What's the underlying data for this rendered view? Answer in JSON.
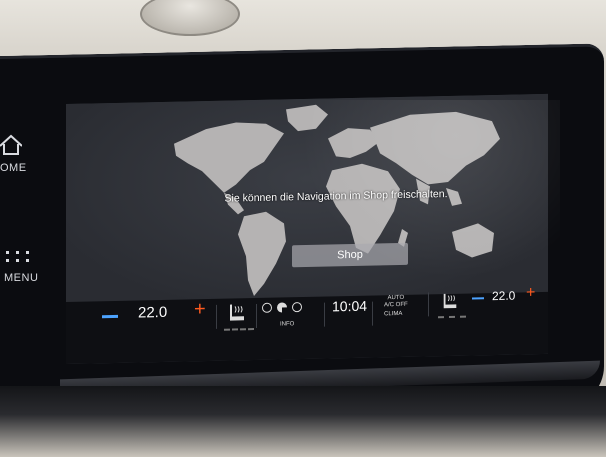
{
  "left_rail": {
    "home_label": "OME",
    "menu_label": "MENU"
  },
  "navigation": {
    "message": "Sie können die Navigation im Shop freischalten.",
    "shop_button_label": "Shop"
  },
  "climate": {
    "left_temp": "22.0",
    "right_temp": "22.0",
    "clock": "10:04",
    "info_label": "INFO",
    "auto_label": "AUTO",
    "ac_off_label": "A/C OFF",
    "climate_label": "CLIMA"
  },
  "colors": {
    "accent_plus": "#ff5a1f",
    "accent_minus": "#4da3ff",
    "screen_bg": "#33363d",
    "bar_bg": "#0e0f13"
  },
  "icons": [
    "home-icon",
    "menu-icon",
    "seat-heat-icon",
    "settings-icon",
    "fan-icon",
    "info-icon"
  ]
}
